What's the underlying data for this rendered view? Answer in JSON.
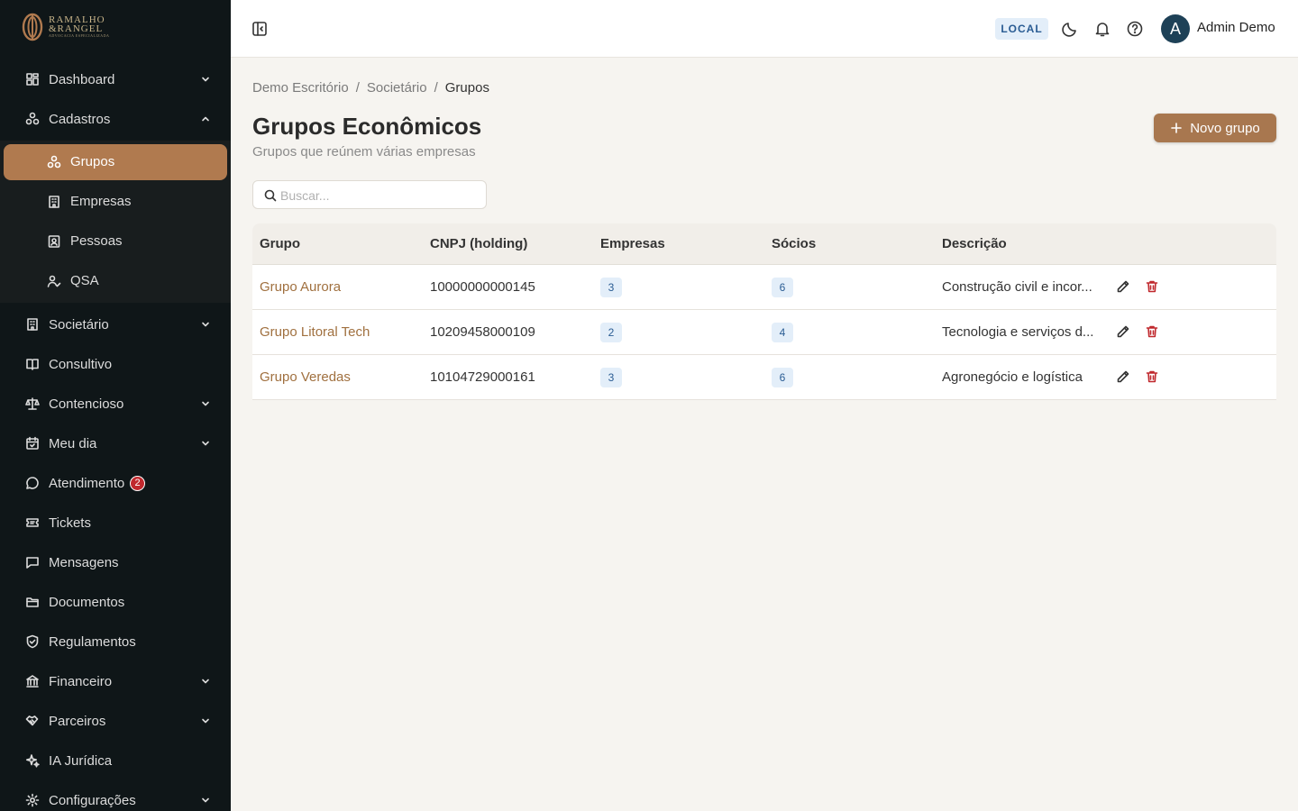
{
  "brand": {
    "line1": "RAMALHO",
    "line2": "&RANGEL",
    "tagline": "ADVOCACIA ESPECIALIZADA"
  },
  "sidebar": {
    "items": [
      {
        "label": "Dashboard",
        "icon": "dashboard-icon"
      },
      {
        "label": "Cadastros",
        "icon": "cadastros-icon"
      },
      {
        "label": "Societário",
        "icon": "building-icon"
      },
      {
        "label": "Consultivo",
        "icon": "book-icon"
      },
      {
        "label": "Contencioso",
        "icon": "scale-icon"
      },
      {
        "label": "Meu dia",
        "icon": "calendar-icon"
      },
      {
        "label": "Atendimento",
        "icon": "chat-icon",
        "badge": "2"
      },
      {
        "label": "Tickets",
        "icon": "ticket-icon"
      },
      {
        "label": "Mensagens",
        "icon": "message-icon"
      },
      {
        "label": "Documentos",
        "icon": "folder-icon"
      },
      {
        "label": "Regulamentos",
        "icon": "shield-icon"
      },
      {
        "label": "Financeiro",
        "icon": "bank-icon"
      },
      {
        "label": "Parceiros",
        "icon": "handshake-icon"
      },
      {
        "label": "IA Jurídica",
        "icon": "sparkle-icon"
      },
      {
        "label": "Configurações",
        "icon": "gear-icon"
      }
    ],
    "sub_items": [
      {
        "label": "Grupos",
        "icon": "groups-icon"
      },
      {
        "label": "Empresas",
        "icon": "building-icon"
      },
      {
        "label": "Pessoas",
        "icon": "person-card-icon"
      },
      {
        "label": "QSA",
        "icon": "user-check-icon"
      }
    ]
  },
  "topbar": {
    "env": "LOCAL",
    "avatar_initial": "A",
    "user_name": "Admin Demo"
  },
  "breadcrumb": {
    "items": [
      "Demo Escritório",
      "Societário",
      "Grupos"
    ],
    "separator": "/"
  },
  "page": {
    "title": "Grupos Econômicos",
    "subtitle": "Grupos que reúnem várias empresas",
    "new_button": "Novo grupo",
    "search_placeholder": "Buscar..."
  },
  "table": {
    "headers": [
      "Grupo",
      "CNPJ (holding)",
      "Empresas",
      "Sócios",
      "Descrição"
    ],
    "rows": [
      {
        "grupo": "Grupo Aurora",
        "cnpj": "10000000000145",
        "empresas": "3",
        "socios": "6",
        "descricao": "Construção civil e incor..."
      },
      {
        "grupo": "Grupo Litoral Tech",
        "cnpj": "10209458000109",
        "empresas": "2",
        "socios": "4",
        "descricao": "Tecnologia e serviços d..."
      },
      {
        "grupo": "Grupo Veredas",
        "cnpj": "10104729000161",
        "empresas": "3",
        "socios": "6",
        "descricao": "Agronegócio e logística"
      }
    ]
  },
  "colors": {
    "accent": "#a8774f",
    "sidebar_bg": "#0f1618",
    "active_item": "#b07a4f",
    "badge_blue_bg": "#e3eef9",
    "badge_blue_text": "#2a5c93",
    "danger": "#c0282d"
  }
}
